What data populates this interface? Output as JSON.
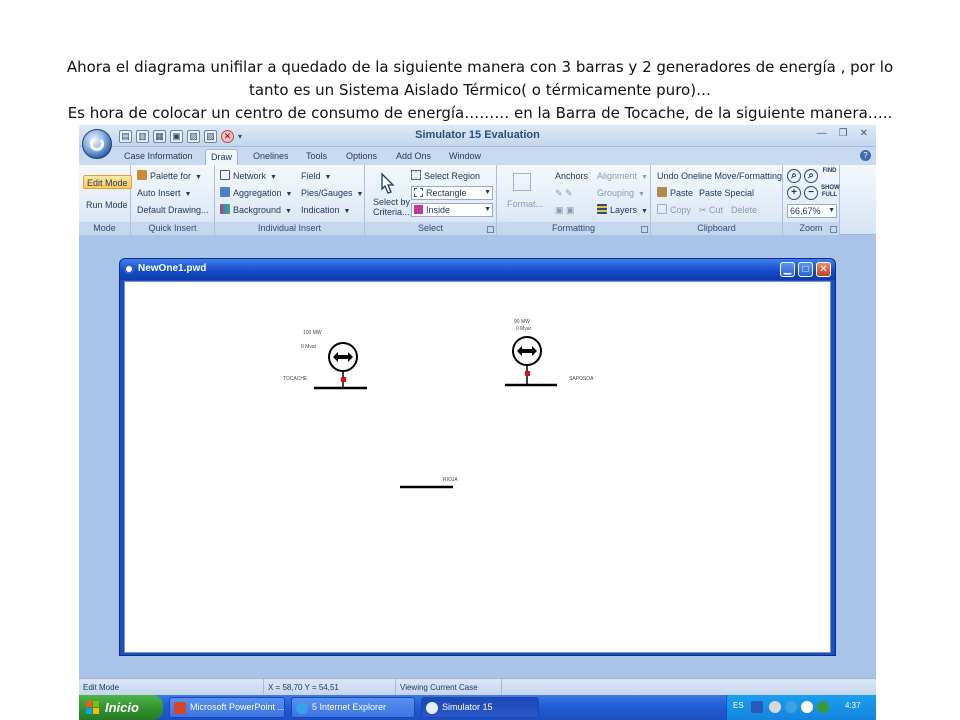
{
  "caption": {
    "line1": "Ahora el diagrama unifilar a quedado de la siguiente manera con 3 barras y 2 generadores de energía , por lo",
    "line2": "tanto es un Sistema Aislado Térmico( o térmicamente puro)…",
    "line3": "Es hora de colocar  un centro de consumo de energía……… en la Barra de Tocache, de la siguiente manera….."
  },
  "app": {
    "title": "Simulator 15 Evaluation",
    "tabs": [
      "Case Information",
      "Draw",
      "Onelines",
      "Tools",
      "Options",
      "Add Ons",
      "Window"
    ],
    "active_tab": "Draw"
  },
  "ribbon": {
    "mode": {
      "edit": "Edit Mode",
      "run": "Run Mode",
      "label": "Mode"
    },
    "quick_insert": {
      "palette": "Palette for",
      "auto_insert": "Auto Insert",
      "default_drawing": "Default Drawing...",
      "label": "Quick Insert"
    },
    "individual_insert": {
      "network": "Network",
      "aggregation": "Aggregation",
      "background": "Background",
      "field": "Field",
      "pies_gauges": "Pies/Gauges",
      "indication": "Indication",
      "label": "Individual Insert"
    },
    "select": {
      "select_by": "Select by",
      "criteria": "Criteria...",
      "select_region": "Select Region",
      "rectangle": "Rectangle",
      "inside": "Inside",
      "label": "Select"
    },
    "formatting": {
      "format": "Format...",
      "anchors": "Anchors",
      "alignment": "Alignment",
      "grouping": "Grouping",
      "layers": "Layers",
      "label": "Formatting"
    },
    "clipboard": {
      "undo": "Undo Oneline Move/Formatting",
      "paste": "Paste",
      "paste_special": "Paste Special",
      "copy": "Copy",
      "cut": "Cut",
      "delete": "Delete",
      "label": "Clipboard"
    },
    "zoom": {
      "find": "FIND",
      "show_full": "SHOW FULL",
      "level": "66,67%",
      "label": "Zoom"
    }
  },
  "document": {
    "title": "NewOne1.pwd",
    "oneline": {
      "generators": [
        {
          "mw": "100 MW",
          "mvar": "0 Mvar",
          "bus": "TOCACHE"
        },
        {
          "mw": "90 MW",
          "mvar": "0 Mvar",
          "bus": "SAPOSOA"
        }
      ],
      "buses": [
        "TOCACHE",
        "SAPOSOA",
        "RIOJA"
      ]
    }
  },
  "status": {
    "mode": "Edit Mode",
    "coords": "X = 58,70 Y = 54,51",
    "view": "Viewing Current Case"
  },
  "taskbar": {
    "start": "Inicio",
    "tasks": [
      "Microsoft PowerPoint ...",
      "5 Internet Explorer",
      "Simulator 15"
    ],
    "lang": "ES",
    "time": "4:37"
  },
  "colors": {
    "generator_breaker": "#e01010",
    "bus": "#000000",
    "window_titlebar": "#1448c8",
    "taskbar": "#245ed6",
    "start_button": "#2f8f2c"
  }
}
